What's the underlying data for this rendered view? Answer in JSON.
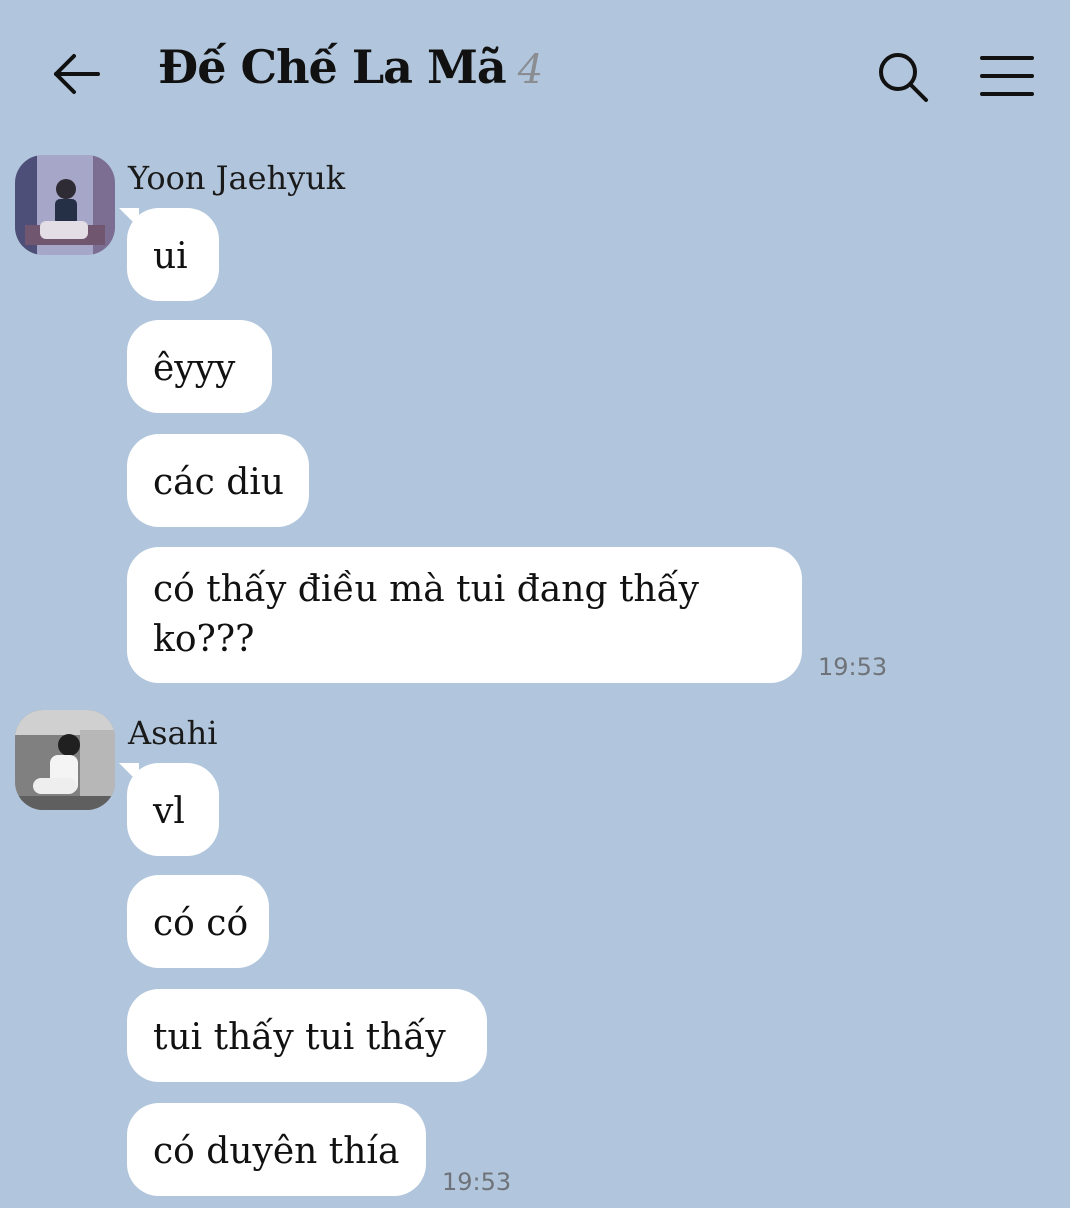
{
  "header": {
    "title": "Đế Chế La Mã",
    "member_count": "4",
    "back_icon": "arrow-left-icon",
    "search_icon": "search-icon",
    "menu_icon": "hamburger-menu-icon"
  },
  "messages": [
    {
      "sender": "Yoon Jaehyuk",
      "avatar": "profile-photo-avatar",
      "bubbles": [
        "ui",
        "êyyy",
        "các diu",
        "có thấy điều mà tui đang thấy ko???"
      ],
      "time": "19:53"
    },
    {
      "sender": "Asahi",
      "avatar": "profile-photo-avatar",
      "bubbles": [
        "vl",
        "có có",
        "tui thấy tui thấy",
        "có duyên thía"
      ],
      "time": "19:53"
    }
  ],
  "colors": {
    "background": "#b1c6dc",
    "bubble": "#ffffff",
    "timestamp": "#6f7379",
    "member_count": "#8a8d92"
  }
}
